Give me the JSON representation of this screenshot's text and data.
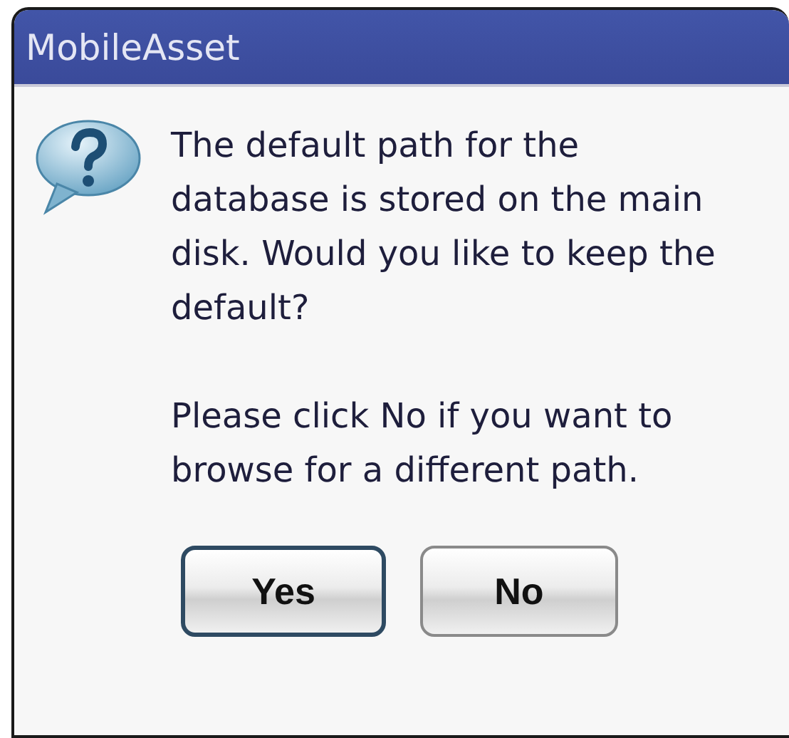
{
  "window": {
    "title": "MobileAsset"
  },
  "message": [
    "The default path for the database is stored on the main disk. Would you like to keep the default?",
    "Please click No if you want to browse for a different path."
  ],
  "buttons": [
    {
      "label": "Yes",
      "default": true
    },
    {
      "label": "No",
      "default": false
    }
  ]
}
